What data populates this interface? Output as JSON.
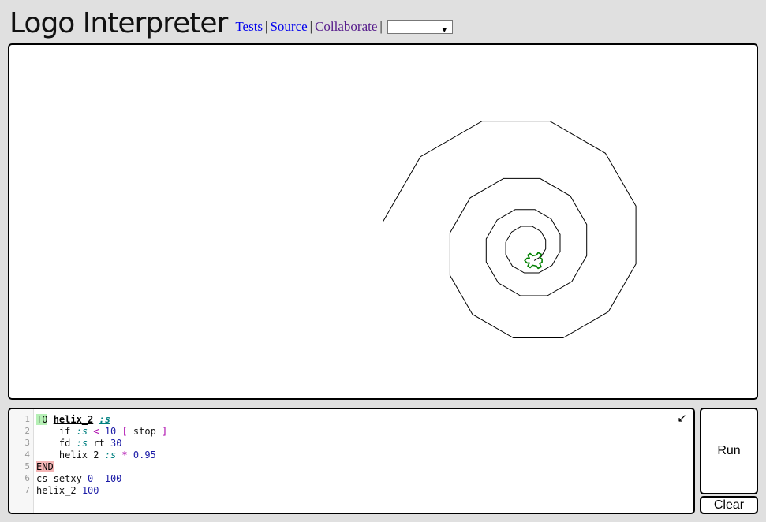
{
  "app": {
    "title": "Logo Interpreter"
  },
  "nav": {
    "tests": "Tests",
    "source": "Source",
    "collaborate": "Collaborate",
    "separator": "|",
    "examples_selected": ""
  },
  "editor": {
    "line_numbers": [
      "1",
      "2",
      "3",
      "4",
      "5",
      "6",
      "7"
    ],
    "lines": {
      "l1": {
        "kw": "TO",
        "proc": "helix_2",
        "param": ":s"
      },
      "l2": {
        "indent": "    ",
        "cmd": "if",
        "var": ":s",
        "op": "<",
        "num": "10",
        "open": "[",
        "stop": "stop",
        "close": "]"
      },
      "l3": {
        "indent": "    ",
        "cmd1": "fd",
        "var": ":s",
        "cmd2": "rt",
        "num": "30"
      },
      "l4": {
        "indent": "    ",
        "cmd": "helix_2",
        "var": ":s",
        "op": "*",
        "num": "0.95"
      },
      "l5": {
        "kw": "END"
      },
      "l6": {
        "cmd": "cs setxy",
        "num1": "0",
        "num2": "-100"
      },
      "l7": {
        "cmd": "helix_2",
        "num": "100"
      }
    },
    "expand_icon": "↙"
  },
  "controls": {
    "run_label": "Run",
    "clear_label": "Clear"
  },
  "drawing": {
    "program": {
      "start": [
        0,
        -100
      ],
      "size": 100,
      "turn": 30,
      "factor": 0.95,
      "min_size": 10
    },
    "line_color": "#000000",
    "turtle_color": "#008000"
  }
}
